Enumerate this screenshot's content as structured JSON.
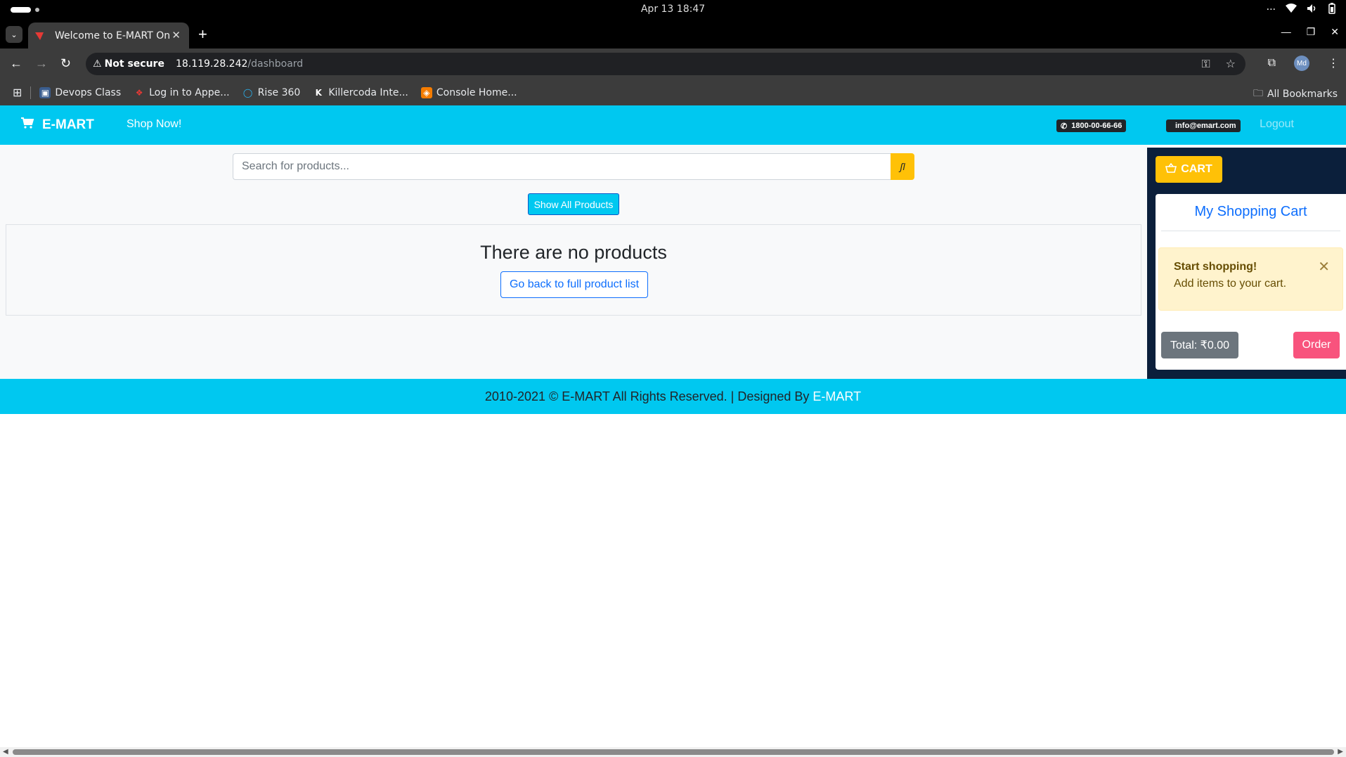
{
  "os": {
    "clock": "Apr 13  18:47",
    "tray_icons": [
      "more-icon",
      "wifi-icon",
      "volume-icon",
      "battery-icon"
    ],
    "tray_more": "···"
  },
  "browser": {
    "tab_title": "Welcome to E-MART Onl",
    "tab_close": "✕",
    "new_tab": "+",
    "not_secure": "Not secure",
    "url_host": "18.119.28.242",
    "url_path": "/dashboard",
    "avatar_initials": "Md",
    "bookmarks": [
      {
        "label": "Devops Class",
        "icon": "devops-icon"
      },
      {
        "label": "Log in to Appe...",
        "icon": "appen-icon"
      },
      {
        "label": "Rise 360",
        "icon": "rise-icon"
      },
      {
        "label": "Killercoda Inte...",
        "icon": "killercoda-icon"
      },
      {
        "label": "Console Home...",
        "icon": "aws-console-icon"
      }
    ],
    "all_bookmarks": "All Bookmarks"
  },
  "navbar": {
    "brand": "E-MART",
    "shop_now": "Shop Now!",
    "phone": "1800-00-66-66",
    "email": "info@emart.com",
    "logout": "Logout"
  },
  "search": {
    "placeholder": "Search for products...",
    "button_glyph": "ʃl"
  },
  "main": {
    "show_all": "Show All Products",
    "empty_title": "There are no products",
    "back_button": "Go back to full product list"
  },
  "cart": {
    "button": "CART",
    "heading": "My Shopping Cart",
    "alert_title": "Start shopping!",
    "alert_text": "Add items to your cart.",
    "alert_close": "✕",
    "total": "Total: ₹0.00",
    "order": "Order"
  },
  "footer": {
    "text": "2010-2021 © E-MART All Rights Reserved. | Designed By ",
    "brand": "E-MART"
  },
  "colors": {
    "accent": "#00c8f0",
    "cart_panel": "#0b1f3b",
    "warning": "#ffc107",
    "order": "#f8537d",
    "primary": "#0d6efd"
  }
}
